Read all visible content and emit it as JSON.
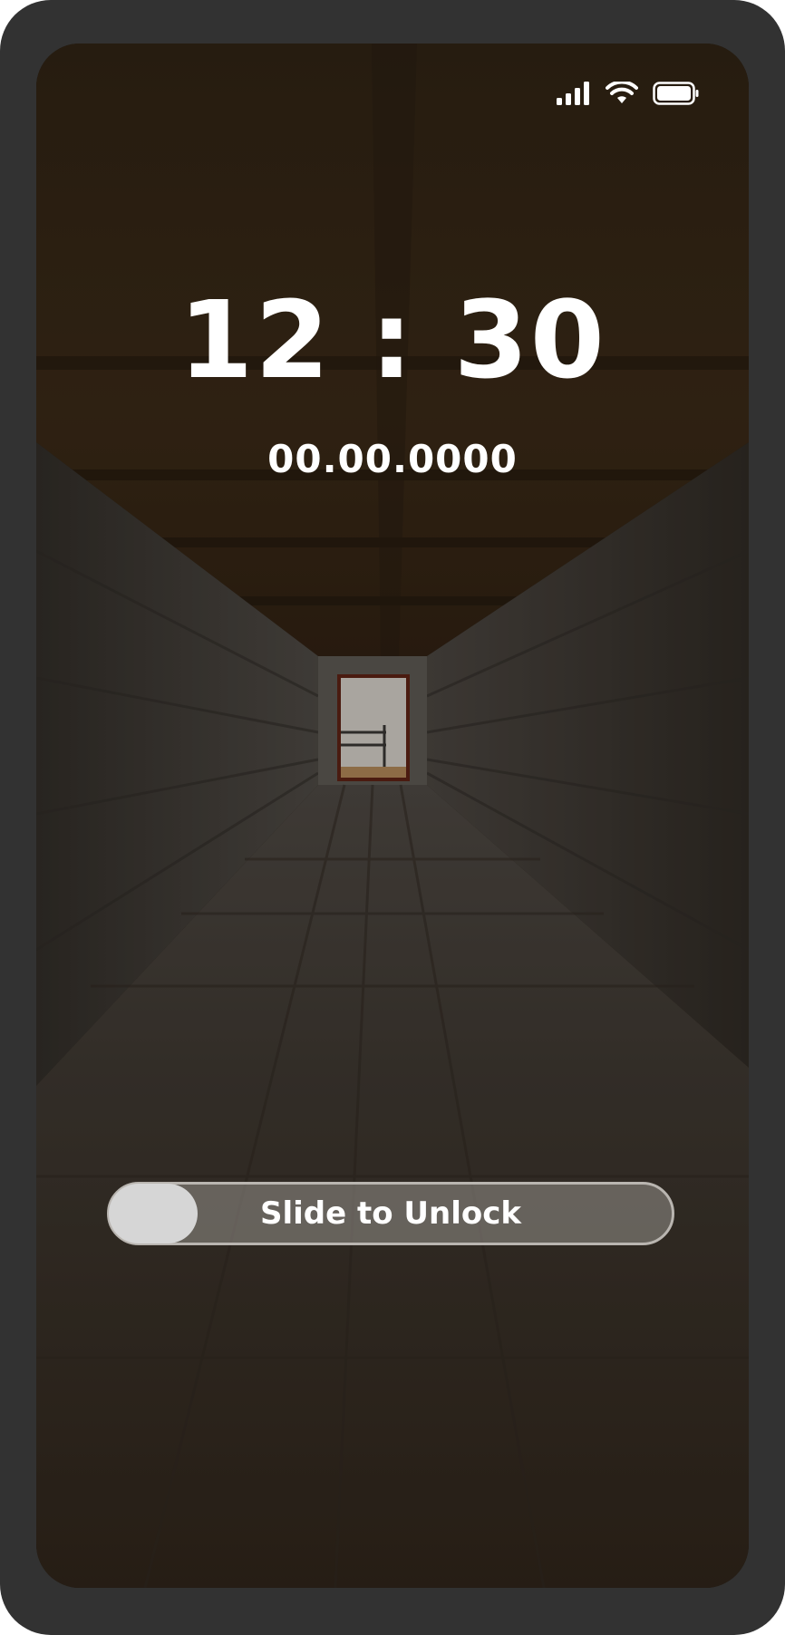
{
  "lock_screen": {
    "time": "12 : 30",
    "date": "00.00.0000",
    "unlock_label": "Slide to Unlock"
  },
  "status_bar": {
    "icons": [
      "cellular-signal-icon",
      "wifi-icon",
      "battery-icon"
    ]
  },
  "colors": {
    "device_frame": "#323232",
    "text": "#ffffff",
    "slider_track_border": "#b9b5b0",
    "slider_knob": "#d6d6d6"
  }
}
